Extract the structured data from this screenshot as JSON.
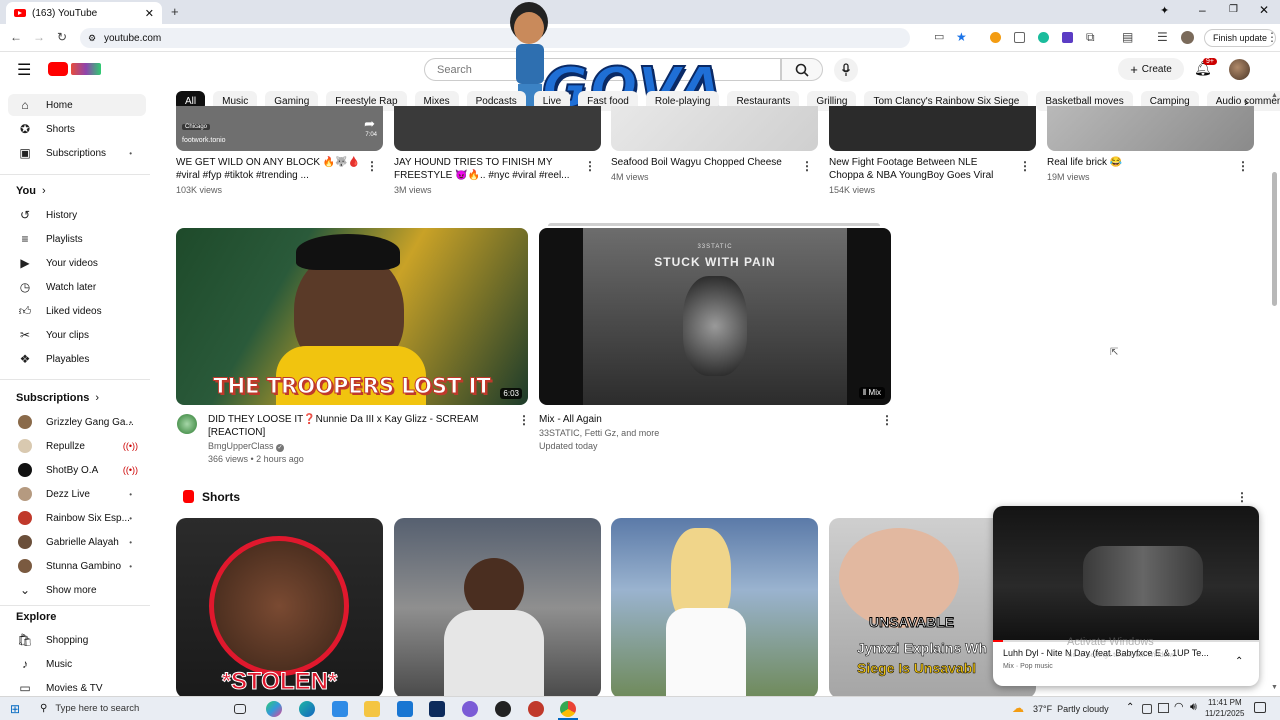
{
  "browser": {
    "tab_title": "(163) YouTube",
    "url": "youtube.com",
    "finish_update": "Finish update"
  },
  "header": {
    "search_placeholder": "Search",
    "create_label": "Create",
    "notif_count": "9+",
    "overlay_text": "GOVA"
  },
  "chips": [
    "All",
    "Music",
    "Gaming",
    "Freestyle Rap",
    "Mixes",
    "Podcasts",
    "Live",
    "Fast food",
    "Role-playing",
    "Restaurants",
    "Grilling",
    "Tom Clancy's Rainbow Six Siege",
    "Basketball moves",
    "Camping",
    "Audio commentaries"
  ],
  "sidebar": {
    "main": [
      "Home",
      "Shorts",
      "Subscriptions"
    ],
    "you_heading": "You",
    "you_items": [
      "History",
      "Playlists",
      "Your videos",
      "Watch later",
      "Liked videos",
      "Your clips",
      "Playables"
    ],
    "subs_heading": "Subscriptions",
    "subs": [
      {
        "name": "Grizzley Gang Ga...",
        "status": "dot",
        "color": "#8a6a4a"
      },
      {
        "name": "Repullze",
        "status": "live",
        "color": "#d9c9b0"
      },
      {
        "name": "ShotBy O.A",
        "status": "live",
        "color": "#111111"
      },
      {
        "name": "Dezz Live",
        "status": "dot",
        "color": "#b59a80"
      },
      {
        "name": "Rainbow Six Esp...",
        "status": "dot",
        "color": "#c0392b"
      },
      {
        "name": "Gabrielle Alayah",
        "status": "dot",
        "color": "#6b4f3a"
      },
      {
        "name": "Stunna Gambino",
        "status": "dot",
        "color": "#7a5a40"
      }
    ],
    "show_more": "Show more",
    "explore_heading": "Explore",
    "explore": [
      "Shopping",
      "Music",
      "Movies & TV"
    ]
  },
  "top_row": [
    {
      "title": "WE GET WILD ON ANY BLOCK 🔥🐺🩸 #viral #fyp #tiktok #trending ...",
      "meta": "103K views",
      "thumb_text": "footwork.tonio",
      "badge": "Chicago",
      "time": "7:04"
    },
    {
      "title": "JAY HOUND TRIES TO FINISH MY FREESTYLE 😈🔥.. #nyc #viral #reel...",
      "meta": "3M views"
    },
    {
      "title": "Seafood Boil Wagyu Chopped Cheese",
      "meta": "4M views"
    },
    {
      "title": "New Fight Footage Between NLE Choppa & NBA YoungBoy Goes Viral",
      "meta": "154K views"
    },
    {
      "title": "Real life brick 😂",
      "meta": "19M views"
    }
  ],
  "videos": [
    {
      "title": "DID THEY LOOSE IT❓Nunnie Da III x Kay Glizz - SCREAM [REACTION]",
      "channel": "BmgUpperClass",
      "meta": "366 views • 2 hours ago",
      "duration": "6:03",
      "thumb_caption": "THE TROOPERS LOST IT"
    },
    {
      "title": "Mix - All Again",
      "channel": "33STATIC, Fetti Gz, and more",
      "meta": "Updated today",
      "badge": "Mix",
      "thumb_caption": "33STATIC",
      "thumb_sub": "STUCK WITH PAIN"
    }
  ],
  "shorts": {
    "heading": "Shorts",
    "items": [
      {
        "caption": "*STOLEN*"
      },
      {
        "caption": ""
      },
      {
        "caption": ""
      },
      {
        "caption": "UNSAVABLE",
        "caption2": "Jynxzi Explains Wh",
        "caption3": "Siege Is Unsavabl"
      }
    ]
  },
  "miniplayer": {
    "title": "Luhh Dyl - Nite N Day (feat. Babyfxce E & 1UP Te...",
    "sub": "Mix · Pop music",
    "watermark": "Activate Windows",
    "watermark_sub": "Go to Settings to activate Windows."
  },
  "taskbar": {
    "search": "Type here to search",
    "weather": "37°F  Partly cloudy",
    "time": "11:41 PM",
    "date": "11/21/2025"
  }
}
